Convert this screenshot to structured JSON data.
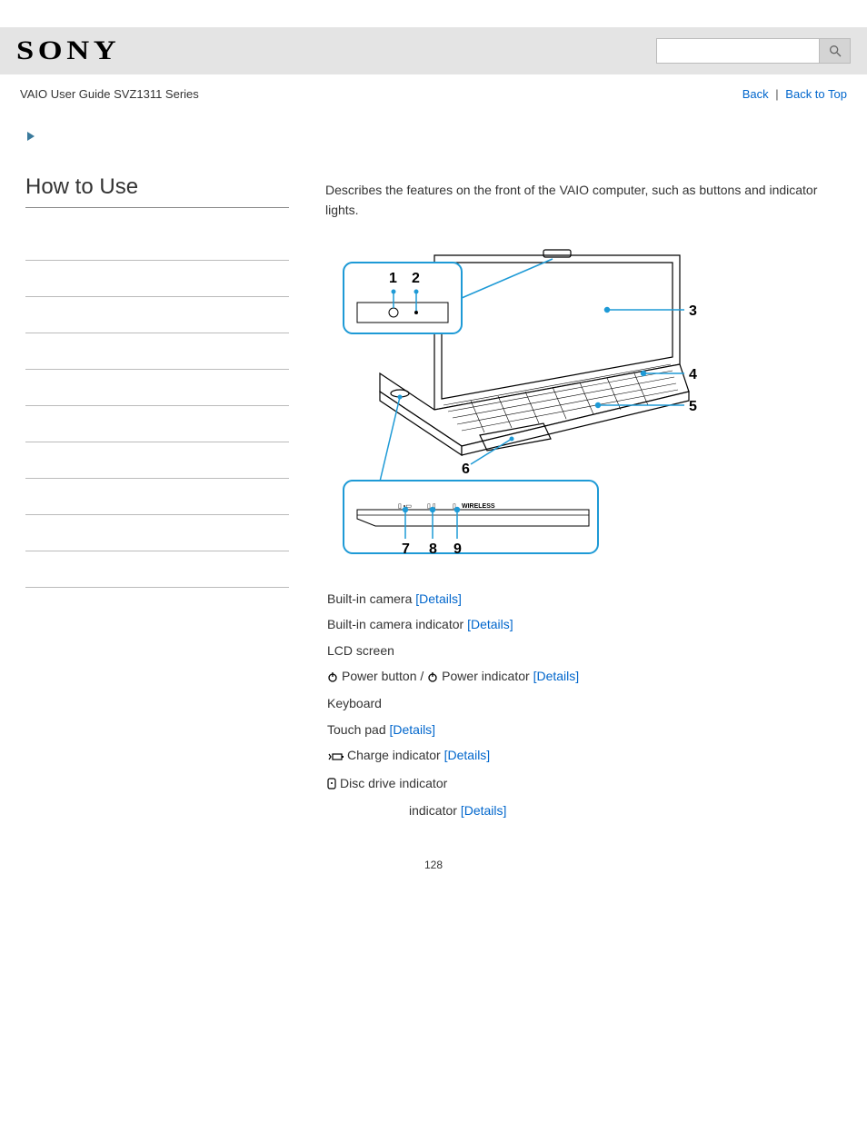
{
  "header": {
    "brand": "SONY",
    "search_placeholder": ""
  },
  "subheader": {
    "breadcrumb": "VAIO User Guide SVZ1311 Series",
    "back_label": "Back",
    "top_label": "Back to Top"
  },
  "sidebar": {
    "title": "How to Use"
  },
  "main": {
    "intro": "Describes the features on the front of the VAIO computer, such as buttons and indicator lights.",
    "details_label": "[Details]",
    "features": {
      "f1": "Built-in camera",
      "f2": "Built-in camera indicator",
      "f3": "LCD screen",
      "f4a": "Power button / ",
      "f4b": "Power indicator",
      "f5": "Keyboard",
      "f6": "Touch pad",
      "f7": "Charge indicator",
      "f8": "Disc drive indicator",
      "f9": "indicator"
    },
    "diagram_labels": {
      "n1": "1",
      "n2": "2",
      "n3": "3",
      "n4": "4",
      "n5": "5",
      "n6": "6",
      "n7": "7",
      "n8": "8",
      "n9": "9",
      "wireless": "WIRELESS"
    }
  },
  "page_number": "128"
}
